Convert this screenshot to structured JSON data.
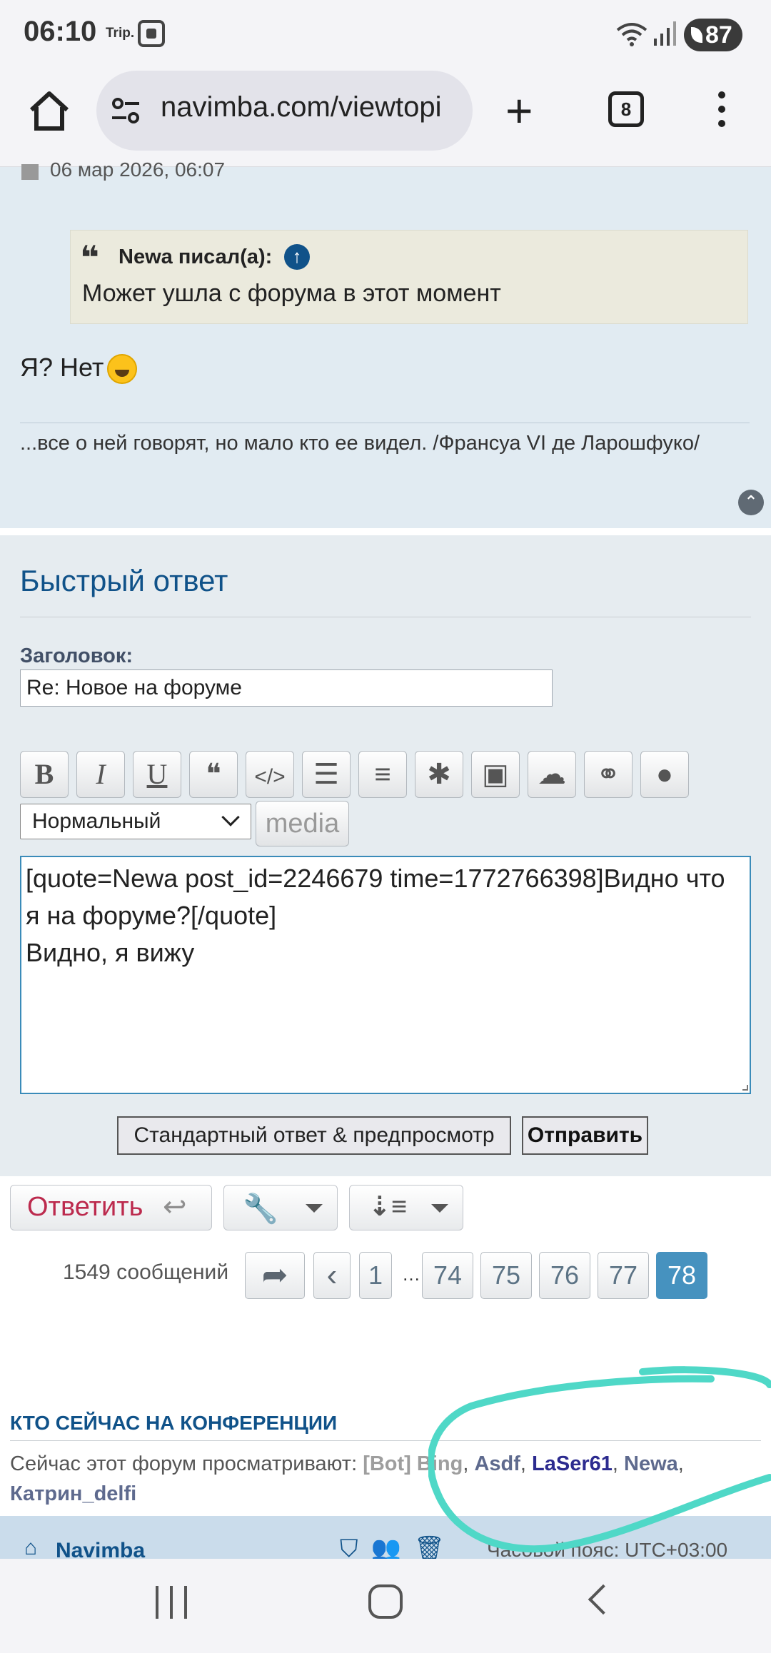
{
  "status_bar": {
    "time": "06:10",
    "carrier_label": "Trip.",
    "battery": "87",
    "icons": [
      "screenshot-icon",
      "wifi-icon",
      "signal-icon",
      "battery-icon"
    ]
  },
  "browser": {
    "url": "navimba.com/viewtopi",
    "tab_count": "8",
    "icons": [
      "home-icon",
      "site-settings-icon",
      "new-tab-icon",
      "tabs-icon",
      "menu-icon"
    ]
  },
  "post": {
    "date": "06 мар 2026, 06:07",
    "quote_author": "Newa писал(а):",
    "quote_text": "Может ушла с форума в этот момент",
    "text": "Я? Нет",
    "signature": "...все о ней говорят, но мало кто ее видел. /Франсуа VI де Ларошфуко/"
  },
  "quick_reply": {
    "title": "Быстрый ответ",
    "subject_label": "Заголовок:",
    "subject_value": "Re: Новое на форуме",
    "toolbar": [
      {
        "name": "bold",
        "glyph": "B"
      },
      {
        "name": "italic",
        "glyph": "I"
      },
      {
        "name": "underline",
        "glyph": "U"
      },
      {
        "name": "quote",
        "glyph": "❝"
      },
      {
        "name": "code",
        "glyph": "</>"
      },
      {
        "name": "list",
        "glyph": "☰"
      },
      {
        "name": "numbered-list",
        "glyph": "≡"
      },
      {
        "name": "list-item",
        "glyph": "✱"
      },
      {
        "name": "image",
        "glyph": "▣"
      },
      {
        "name": "upload",
        "glyph": "☁"
      },
      {
        "name": "link",
        "glyph": "⚭"
      },
      {
        "name": "color",
        "glyph": "●"
      }
    ],
    "font_size": "Нормальный",
    "media_label": "media",
    "message": "[quote=Newa post_id=2246679 time=1772766398]Видно что я на форуме?[/quote]\nВидно, я вижу",
    "preview_label": "Стандартный ответ & предпросмотр",
    "submit_label": "Отправить"
  },
  "actions": {
    "reply_label": "Ответить"
  },
  "pagination": {
    "count_label": "1549 сообщений",
    "pages": [
      "1",
      "74",
      "75",
      "76",
      "77",
      "78"
    ],
    "ellipsis": "…",
    "current": "78"
  },
  "online": {
    "title": "КТО СЕЙЧАС НА КОНФЕРЕНЦИИ",
    "prefix": "Сейчас этот форум просматривают:",
    "users": [
      "[Bot] Bing",
      "Asdf",
      "LaSer61",
      "Newa",
      "Катрин_delfi"
    ]
  },
  "footer": {
    "home_label": "Navimba",
    "timezone": "Часовой пояс: UTC+03:00"
  },
  "colors": {
    "link": "#105289",
    "accent_page": "#4692bf",
    "reply": "#bc2a4d",
    "scribble": "#4fd8c7"
  }
}
